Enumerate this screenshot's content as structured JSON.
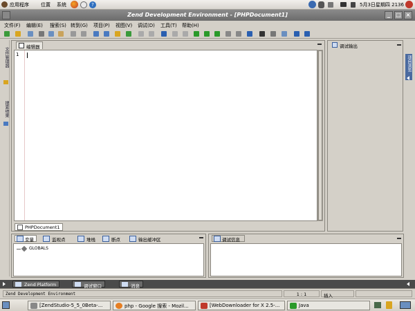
{
  "gnome_panel": {
    "menus": [
      "应用程序",
      "位置",
      "系统"
    ],
    "clock": "5月3日星期四 2136"
  },
  "window": {
    "title": "Zend Development Environment - [PHPDocument1]",
    "buttons": [
      "_",
      "□",
      "×"
    ]
  },
  "menubar": {
    "items": [
      "文件(F)",
      "编辑(E)",
      "搜索(S)",
      "转到(G)",
      "项目(P)",
      "视图(V)",
      "调试(D)",
      "工具(T)",
      "帮助(H)"
    ]
  },
  "left_strip": {
    "labels": [
      "文件管理器",
      "搜索结果"
    ]
  },
  "editor": {
    "tab_label": "编辑器",
    "line_number": "1",
    "document_tab": "PHPDocument1"
  },
  "right_panel": {
    "tab_label": "调试输出",
    "strip_label": "项目浏览"
  },
  "bottom_left": {
    "tabs": [
      "变量",
      "监视点",
      "堆栈",
      "断点",
      "输出缓冲区"
    ],
    "tree_item": "GLOBALS"
  },
  "bottom_right": {
    "tab_label": "调试信息"
  },
  "bottom_tabs": [
    "Zend Platform",
    "调试窗口",
    "消息"
  ],
  "statusbar": {
    "message": "Zend Development Environment",
    "position": "1 : 1",
    "mode": "插入"
  },
  "taskbar": {
    "tasks": [
      "[ZendStudio-5_5_0Beta-...",
      "php - Google 搜索 - Mozil...",
      "[WebDownloader for X 2.5-...",
      "Java"
    ]
  },
  "colors": {
    "title_bar": "#6c6c6c",
    "panel_bg": "#d4d0c8",
    "gutter_border": "#e6c8c8"
  }
}
